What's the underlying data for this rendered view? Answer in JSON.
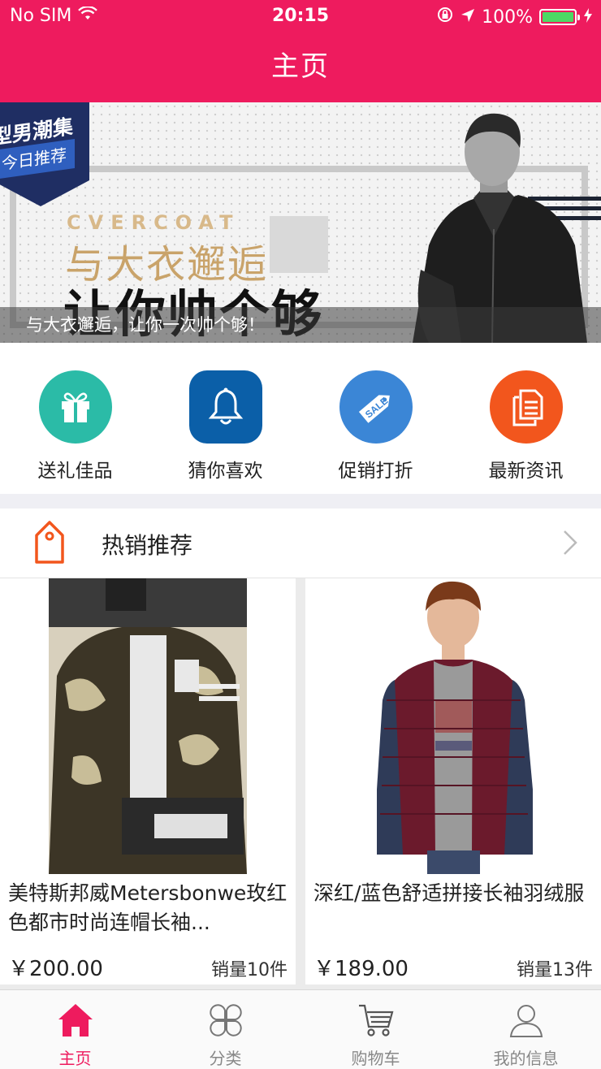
{
  "status_bar": {
    "carrier": "No SIM",
    "time": "20:15",
    "battery": "100%",
    "battery_level": 1.0
  },
  "nav": {
    "title": "主页"
  },
  "banner": {
    "tag_line1": "型男潮集",
    "tag_line2": "今日推荐",
    "english": "CVERCOAT",
    "headline": "与大衣邂逅",
    "subheadline": "让你帅个够",
    "caption": "与大衣邂逅，让你一次帅个够！"
  },
  "categories": [
    {
      "label": "送礼佳品",
      "icon": "gift-icon",
      "color": "#2bbba7"
    },
    {
      "label": "猜你喜欢",
      "icon": "bell-icon",
      "color": "#0b5fa8"
    },
    {
      "label": "促销打折",
      "icon": "sale-tag-icon",
      "color": "#3b86d6"
    },
    {
      "label": "最新资讯",
      "icon": "document-icon",
      "color": "#f2561d"
    }
  ],
  "section": {
    "title": "热销推荐",
    "icon": "price-tag-icon"
  },
  "products": [
    {
      "name": "美特斯邦威Metersbonwe玫红色都市时尚连帽长袖...",
      "price": "￥200.00",
      "sales": "销量10件"
    },
    {
      "name": "深红/蓝色舒适拼接长袖羽绒服",
      "price": "￥189.00",
      "sales": "销量13件"
    }
  ],
  "tabs": [
    {
      "label": "主页",
      "icon": "home-icon",
      "active": true
    },
    {
      "label": "分类",
      "icon": "category-icon",
      "active": false
    },
    {
      "label": "购物车",
      "icon": "cart-icon",
      "active": false
    },
    {
      "label": "我的信息",
      "icon": "profile-icon",
      "active": false
    }
  ],
  "colors": {
    "brand": "#ee1b5e",
    "background": "#efeff4"
  }
}
